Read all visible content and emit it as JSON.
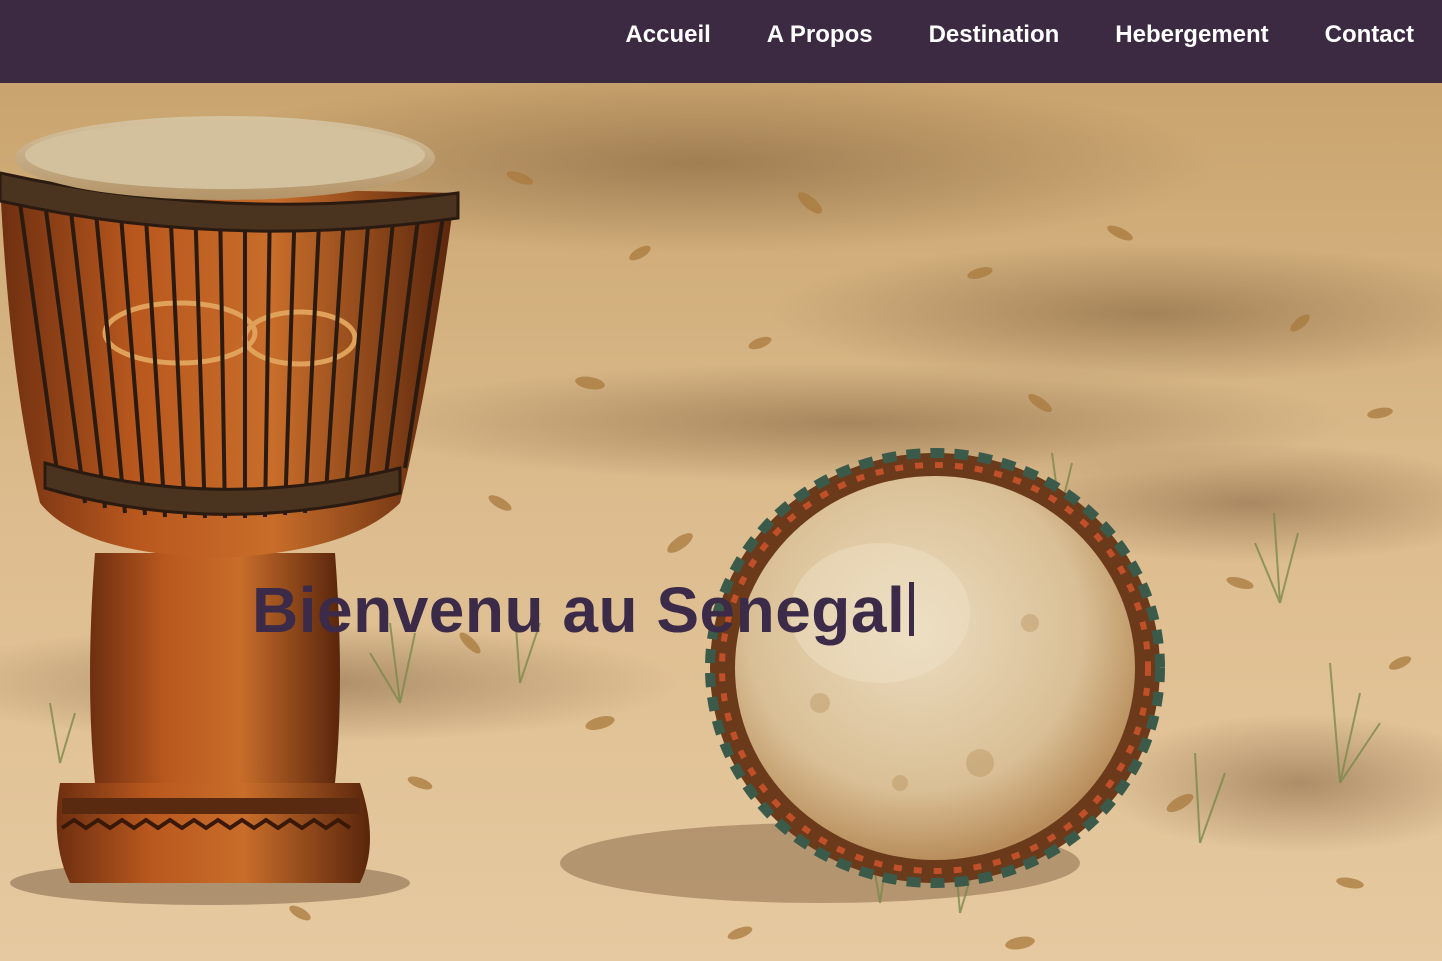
{
  "nav": {
    "items": [
      {
        "label": "Accueil"
      },
      {
        "label": "A Propos"
      },
      {
        "label": "Destination"
      },
      {
        "label": "Hebergement"
      },
      {
        "label": "Contact"
      }
    ]
  },
  "hero": {
    "title": "Bienvenu au Senegal"
  },
  "colors": {
    "navbar": "#3b2a42",
    "title": "#3b2a48",
    "nav_text": "#ffffff"
  }
}
